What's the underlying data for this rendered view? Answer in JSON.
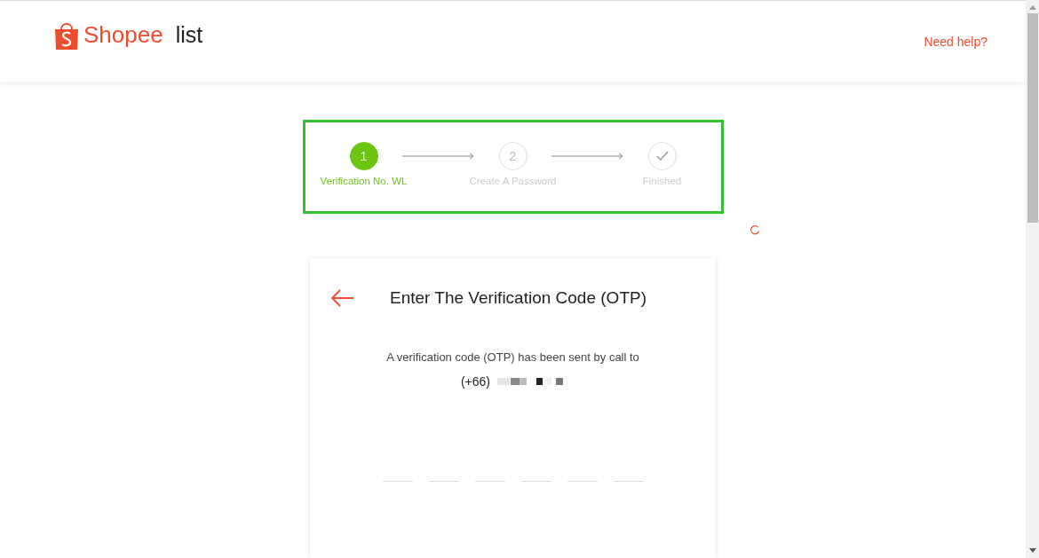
{
  "header": {
    "logo": "Shopee",
    "page_title": "list",
    "help_link": "Need help?"
  },
  "steps": [
    {
      "kind": "number",
      "number": "1",
      "label": "Verification No. WL",
      "selected": true
    },
    {
      "kind": "number",
      "number": "2",
      "label": "Create A Password",
      "selected": false
    },
    {
      "kind": "check",
      "label": "Finished",
      "selected": false
    }
  ],
  "card": {
    "title": "Enter The Verification Code (OTP)",
    "message": "A verification code (OTP) has been sent by call to",
    "country_code": "(+66)",
    "otp_fields": [
      {
        "kind": "digit"
      },
      {
        "kind": "digit"
      },
      {
        "kind": "digit"
      },
      {
        "kind": "digit"
      },
      {
        "kind": "digit"
      },
      {
        "kind": "digit"
      }
    ]
  }
}
